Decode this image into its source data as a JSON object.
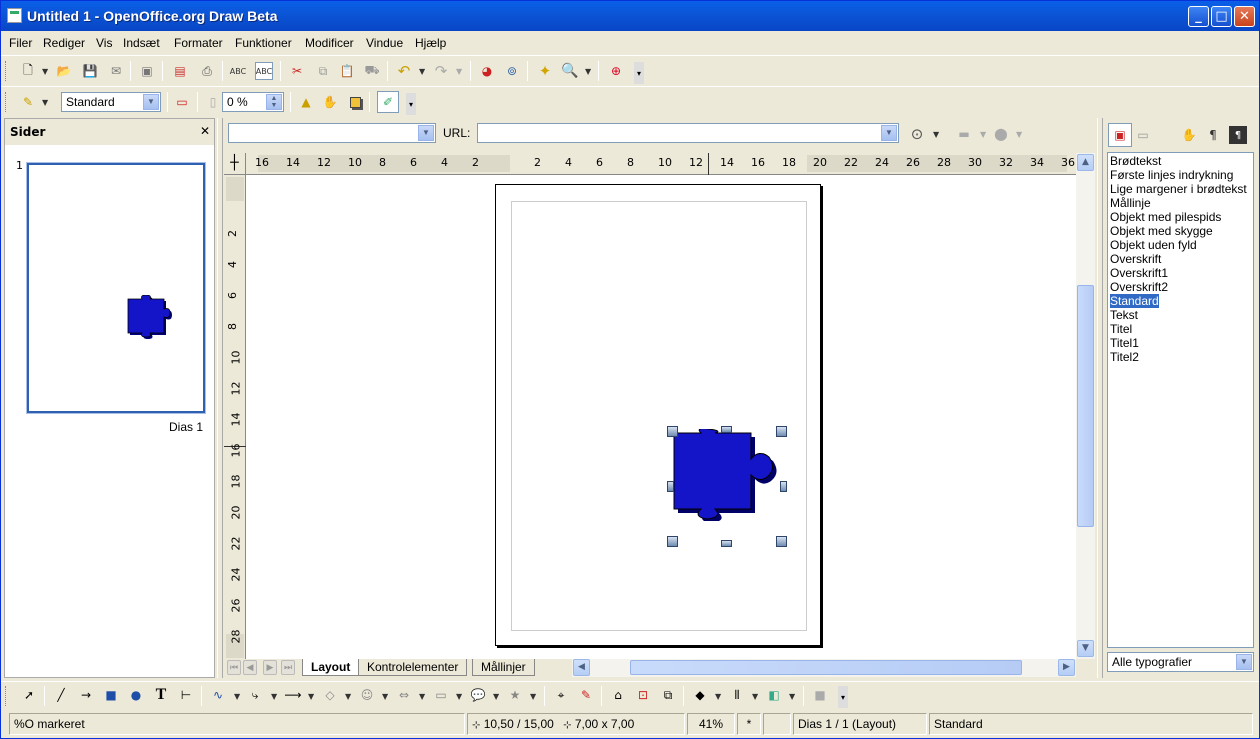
{
  "window": {
    "title": "Untitled 1 - OpenOffice.org Draw Beta"
  },
  "menubar": [
    {
      "label": "Filer"
    },
    {
      "label": "Rediger"
    },
    {
      "label": "Vis"
    },
    {
      "label": "Indsæt"
    },
    {
      "label": "Formater"
    },
    {
      "label": "Funktioner"
    },
    {
      "label": "Modificer"
    },
    {
      "label": "Vindue"
    },
    {
      "label": "Hjælp"
    }
  ],
  "line_toolbar": {
    "style_value": "Standard",
    "transparency_value": "0 %"
  },
  "hyperlink_bar": {
    "url_label": "URL:",
    "target_value": "",
    "url_value": ""
  },
  "pages_panel": {
    "title": "Sider",
    "page_number": "1",
    "slide_label": "Dias 1"
  },
  "ruler": {
    "h_ticks": [
      "16",
      "14",
      "12",
      "10",
      "8",
      "6",
      "4",
      "2",
      "2",
      "4",
      "6",
      "8",
      "10",
      "12",
      "14",
      "16",
      "18",
      "20",
      "22",
      "24",
      "26",
      "28",
      "30",
      "32",
      "34",
      "36"
    ],
    "v_ticks": [
      "2",
      "4",
      "6",
      "8",
      "10",
      "12",
      "14",
      "16",
      "18",
      "20",
      "22",
      "24",
      "26",
      "28"
    ]
  },
  "tabs": [
    {
      "label": "Layout"
    },
    {
      "label": "Kontrolelementer"
    },
    {
      "label": "Mållinjer"
    }
  ],
  "stylist": {
    "styles": [
      "Brødtekst",
      "Første linjes indrykning",
      "Lige margener i brødtekst",
      "Mållinje",
      "Objekt med pilespids",
      "Objekt med skygge",
      "Objekt uden fyld",
      "Overskrift",
      "Overskrift1",
      "Overskrift2",
      "Standard",
      "Tekst",
      "Titel",
      "Titel1",
      "Titel2"
    ],
    "selected": "Standard",
    "filter_value": "Alle typografier"
  },
  "statusbar": {
    "selection": "%O markeret",
    "position": "10,50 / 15,00",
    "size": "7,00 x 7,00",
    "zoom": "41%",
    "modified": "*",
    "page": "Dias 1 / 1 (Layout)",
    "style": "Standard"
  },
  "colors": {
    "title_bar": "#0A5FE8",
    "selection": "#316AC5",
    "puzzle": "#1414C8"
  }
}
